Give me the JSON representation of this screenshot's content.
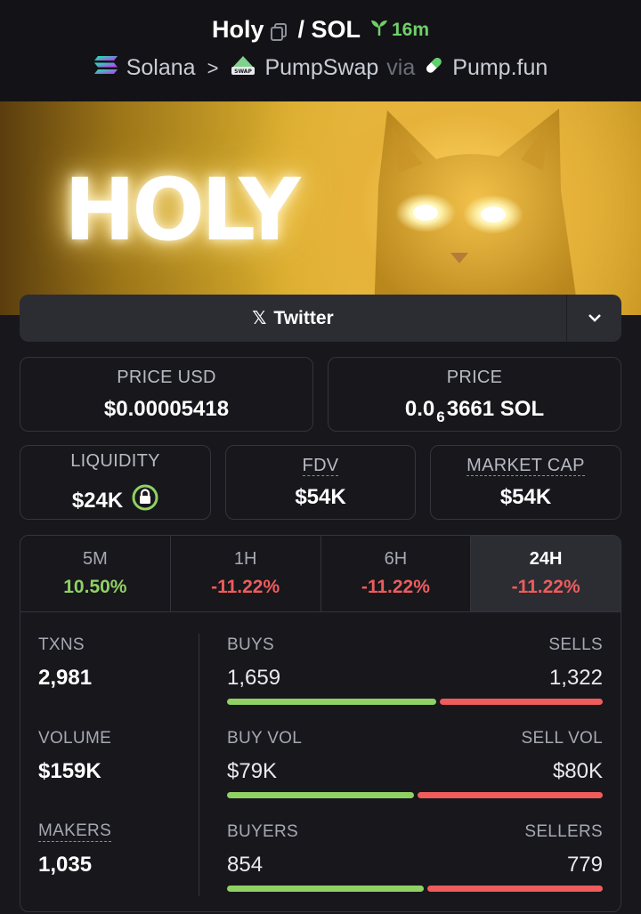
{
  "header": {
    "token": "Holy",
    "slash_pair": "/ SOL",
    "age": "16m",
    "chain": "Solana",
    "dex": "PumpSwap",
    "via": "via",
    "launchpad": "Pump.fun"
  },
  "banner": {
    "word": "HOLY"
  },
  "twitter": {
    "label": "Twitter"
  },
  "price_usd": {
    "label": "PRICE USD",
    "value": "$0.00005418"
  },
  "price_sol": {
    "label": "PRICE",
    "prefix": "0.0",
    "zeros": "6",
    "rest": "3661 SOL"
  },
  "liquidity": {
    "label": "LIQUIDITY",
    "value": "$24K"
  },
  "fdv": {
    "label": "FDV",
    "value": "$54K"
  },
  "market_cap": {
    "label": "MARKET CAP",
    "value": "$54K"
  },
  "tabs": [
    {
      "label": "5M",
      "value": "10.50%"
    },
    {
      "label": "1H",
      "value": "-11.22%"
    },
    {
      "label": "6H",
      "value": "-11.22%"
    },
    {
      "label": "24H",
      "value": "-11.22%"
    }
  ],
  "txns": {
    "label": "TXNS",
    "value": "2,981",
    "left_label": "BUYS",
    "left_value": "1,659",
    "right_label": "SELLS",
    "right_value": "1,322",
    "buy_fraction": 0.557
  },
  "volume": {
    "label": "VOLUME",
    "value": "$159K",
    "left_label": "BUY VOL",
    "left_value": "$79K",
    "right_label": "SELL VOL",
    "right_value": "$80K",
    "buy_fraction": 0.497
  },
  "makers": {
    "label": "MAKERS",
    "value": "1,035",
    "left_label": "BUYERS",
    "left_value": "854",
    "right_label": "SELLERS",
    "right_value": "779",
    "buy_fraction": 0.523
  },
  "colors": {
    "positive": "#8fd163",
    "negative": "#ee5c5c",
    "age_green": "#6fd069",
    "panel": "#2c2c33",
    "background": "#17171c"
  }
}
